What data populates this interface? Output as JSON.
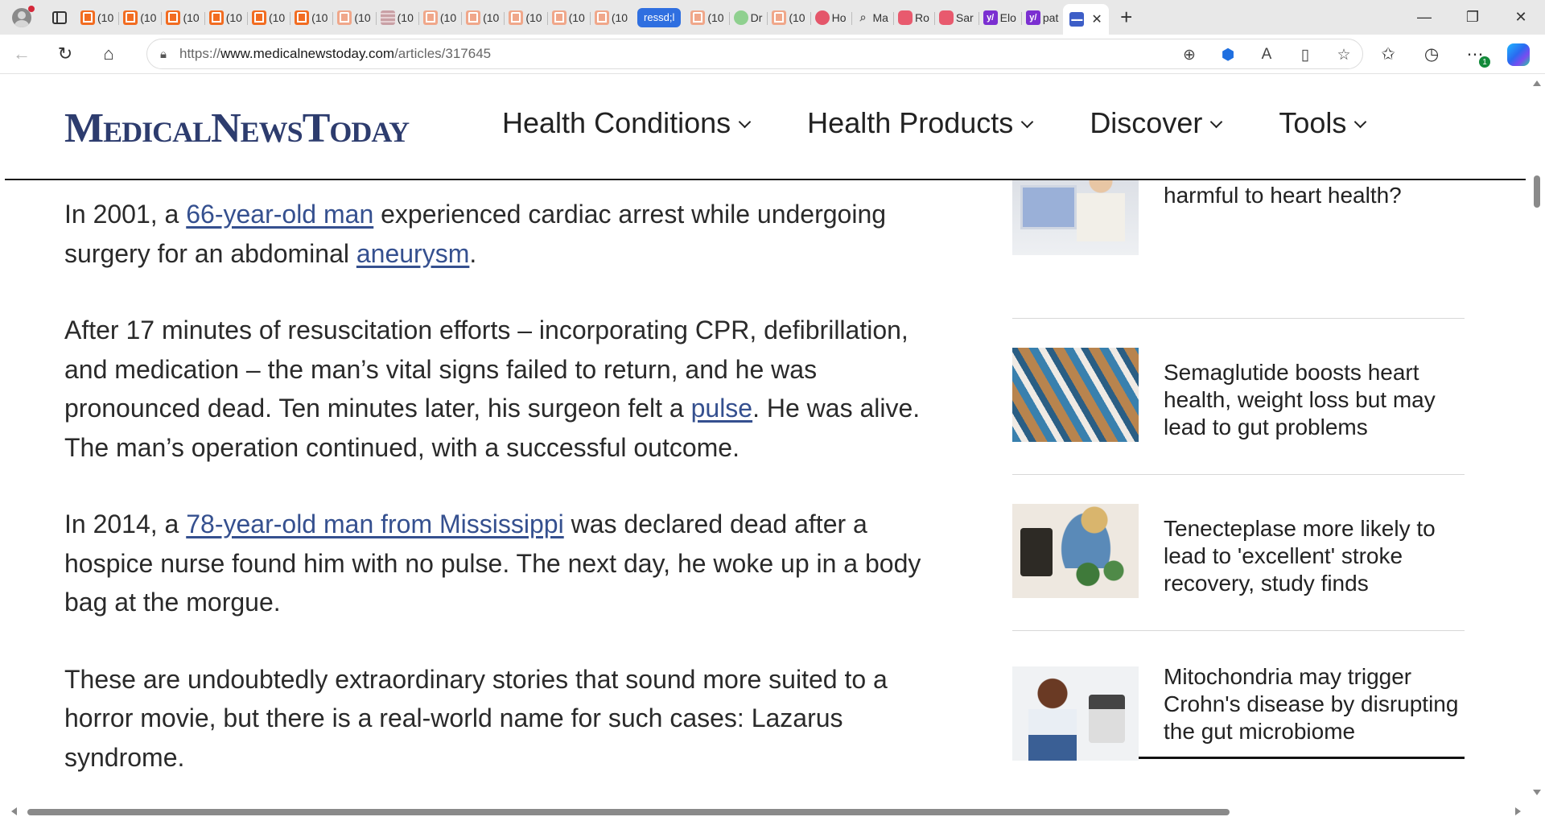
{
  "browser": {
    "tabs": [
      {
        "label": "(10",
        "icon": "orange-bookmark-icon"
      },
      {
        "label": "(10",
        "icon": "orange-bookmark-icon"
      },
      {
        "label": "(10",
        "icon": "orange-bookmark-icon"
      },
      {
        "label": "(10",
        "icon": "orange-bookmark-icon"
      },
      {
        "label": "(10",
        "icon": "orange-bookmark-icon"
      },
      {
        "label": "(10",
        "icon": "orange-bookmark-icon"
      },
      {
        "label": "(10",
        "icon": "peach-bookmark-icon"
      },
      {
        "label": "(10",
        "icon": "grid-icon"
      },
      {
        "label": "(10",
        "icon": "peach-bookmark-icon"
      },
      {
        "label": "(10",
        "icon": "peach-bookmark-icon"
      },
      {
        "label": "(10",
        "icon": "peach-bookmark-icon"
      },
      {
        "label": "(10",
        "icon": "peach-bookmark-icon"
      },
      {
        "label": "(10",
        "icon": "peach-bookmark-icon"
      }
    ],
    "highlight_tab": "ressd;l",
    "tabs_after": [
      {
        "label": "(10",
        "icon": "peach-bookmark-icon"
      },
      {
        "label": "Dr",
        "icon": "play-icon"
      },
      {
        "label": "(10",
        "icon": "peach-bookmark-icon"
      },
      {
        "label": "Ho",
        "icon": "red-podcast-icon"
      },
      {
        "label": "Ma",
        "icon": "search-icon"
      },
      {
        "label": "Ro",
        "icon": "youtube-icon"
      },
      {
        "label": "Sar",
        "icon": "youtube-icon"
      },
      {
        "label": "Elo",
        "icon": "yahoo-icon"
      },
      {
        "label": "pat",
        "icon": "yahoo-icon"
      }
    ],
    "active_tab_favicon": "mnt-icon",
    "address": {
      "prefix": "https://",
      "host": "www.medicalnewstoday.com",
      "path": "/articles/317645"
    },
    "toolbar_badge": "1"
  },
  "site": {
    "logo": "MedicalNewsToday",
    "nav": [
      {
        "label": "Health Conditions"
      },
      {
        "label": "Health Products"
      },
      {
        "label": "Discover"
      },
      {
        "label": "Tools"
      }
    ]
  },
  "article": {
    "p1": {
      "t1": "In 2001, a ",
      "link1": "66-year-old man",
      "t2": " experienced cardiac arrest while undergoing surgery for an abdominal ",
      "link2": "aneurysm",
      "t3": "."
    },
    "p2": {
      "t1": "After 17 minutes of resuscitation efforts – incorporating CPR, defibrillation, and medication – the man’s vital signs failed to return, and he was pronounced dead. Ten minutes later, his surgeon felt a ",
      "link1": "pulse",
      "t2": ". He was alive. The man’s operation continued, with a successful outcome."
    },
    "p3": {
      "t1": "In 2014, a ",
      "link1": "78-year-old man from Mississippi",
      "t2": " was declared dead after a hospice nurse found him with no pulse. The next day, he woke up in a body bag at the morgue."
    },
    "p4": {
      "t1": "These are undoubtedly extraordinary stories that sound more suited to a horror movie, but there is a real-world name for such cases: Lazarus syndrome."
    }
  },
  "sidebar": [
    {
      "title": "Can standing too much be harmful to heart health?"
    },
    {
      "title": "Semaglutide boosts heart health, weight loss but may lead to gut problems"
    },
    {
      "title": "Tenecteplase more likely to lead to 'excellent' stroke recovery, study finds"
    },
    {
      "title": "Mitochondria may trigger Crohn's disease by disrupting the gut microbiome"
    }
  ]
}
